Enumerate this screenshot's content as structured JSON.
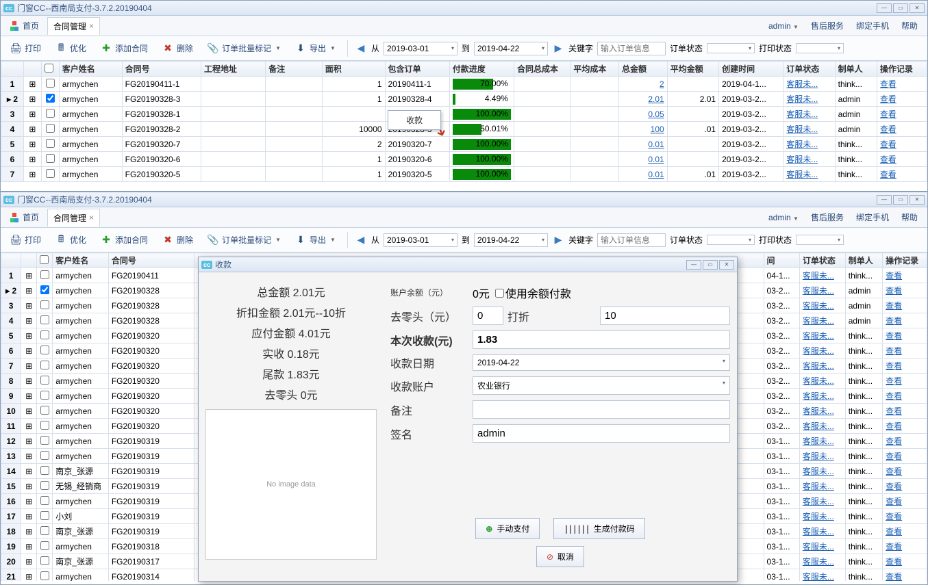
{
  "app_title": "门窗CC--西南局支付-3.7.2.20190404",
  "tabs": {
    "home": "首页",
    "contract": "合同管理"
  },
  "user": {
    "name": "admin",
    "menu1": "售后服务",
    "menu2": "绑定手机",
    "menu3": "帮助"
  },
  "toolbar": {
    "print": "打印",
    "optimize": "优化",
    "add": "添加合同",
    "delete": "删除",
    "batch": "订单批量标记",
    "export": "导出",
    "from": "从",
    "to": "到",
    "date1": "2019-03-01",
    "date2": "2019-04-22",
    "keyword": "关键字",
    "search_ph": "输入订单信息",
    "status": "订单状态",
    "pstatus": "打印状态"
  },
  "cols": [
    "",
    "",
    "",
    "客户姓名",
    "合同号",
    "工程地址",
    "备注",
    "面积",
    "包含订单",
    "付款进度",
    "合同总成本",
    "平均成本",
    "总金额",
    "平均金额",
    "创建时间",
    "订单状态",
    "制单人",
    "操作记录"
  ],
  "ctx": "收款",
  "rows_top": [
    {
      "n": "1",
      "name": "armychen",
      "no": "FG20190411-1",
      "area": "1",
      "order": "20190411-1",
      "prog": 70,
      "ptxt": "70.00%",
      "total": "2",
      "created": "2019-04-1...",
      "status": "客服未...",
      "user": "think...",
      "op": "查看"
    },
    {
      "n": "2",
      "sel": true,
      "cur": true,
      "name": "armychen",
      "no": "FG20190328-3",
      "area": "1",
      "order": "20190328-4",
      "prog": 4.49,
      "ptxt": "4.49%",
      "total": "2.01",
      "avg": "2.01",
      "created": "2019-03-2...",
      "status": "客服未...",
      "user": "admin",
      "op": "查看"
    },
    {
      "n": "3",
      "name": "armychen",
      "no": "FG20190328-1",
      "area": "",
      "order": "",
      "prog": 100,
      "ptxt": "100.00%",
      "total": "0.05",
      "created": "2019-03-2...",
      "status": "客服未...",
      "user": "admin",
      "op": "查看"
    },
    {
      "n": "4",
      "name": "armychen",
      "no": "FG20190328-2",
      "area": "10000",
      "order": "20190328-3",
      "prog": 50,
      "ptxt": "50.01%",
      "total": "100",
      "avg": ".01",
      "created": "2019-03-2...",
      "status": "客服未...",
      "user": "admin",
      "op": "查看"
    },
    {
      "n": "5",
      "name": "armychen",
      "no": "FG20190320-7",
      "area": "2",
      "order": "20190320-7",
      "prog": 100,
      "ptxt": "100.00%",
      "total": "0.01",
      "created": "2019-03-2...",
      "status": "客服未...",
      "user": "think...",
      "op": "查看"
    },
    {
      "n": "6",
      "name": "armychen",
      "no": "FG20190320-6",
      "area": "1",
      "order": "20190320-6",
      "prog": 100,
      "ptxt": "100.00%",
      "total": "0.01",
      "created": "2019-03-2...",
      "status": "客服未...",
      "user": "think...",
      "op": "查看"
    },
    {
      "n": "7",
      "name": "armychen",
      "no": "FG20190320-5",
      "area": "1",
      "order": "20190320-5",
      "prog": 100,
      "ptxt": "100.00%",
      "total": "0.01",
      "avg": ".01",
      "created": "2019-03-2...",
      "status": "客服未...",
      "user": "think...",
      "op": "查看"
    }
  ],
  "cols2": [
    "",
    "",
    "",
    "客户姓名",
    "合同号",
    "间",
    "订单状态",
    "制单人",
    "操作记录"
  ],
  "rows_bottom": [
    {
      "n": "1",
      "name": "armychen",
      "no": "FG20190411",
      "t": "04-1...",
      "status": "客服未...",
      "user": "think...",
      "op": "查看"
    },
    {
      "n": "2",
      "sel": true,
      "cur": true,
      "name": "armychen",
      "no": "FG20190328",
      "t": "03-2...",
      "status": "客服未...",
      "user": "admin",
      "op": "查看"
    },
    {
      "n": "3",
      "name": "armychen",
      "no": "FG20190328",
      "t": "03-2...",
      "status": "客服未...",
      "user": "admin",
      "op": "查看"
    },
    {
      "n": "4",
      "name": "armychen",
      "no": "FG20190328",
      "t": "03-2...",
      "status": "客服未...",
      "user": "admin",
      "op": "查看"
    },
    {
      "n": "5",
      "name": "armychen",
      "no": "FG20190320",
      "t": "03-2...",
      "status": "客服未...",
      "user": "think...",
      "op": "查看"
    },
    {
      "n": "6",
      "name": "armychen",
      "no": "FG20190320",
      "t": "03-2...",
      "status": "客服未...",
      "user": "think...",
      "op": "查看"
    },
    {
      "n": "7",
      "name": "armychen",
      "no": "FG20190320",
      "t": "03-2...",
      "status": "客服未...",
      "user": "think...",
      "op": "查看"
    },
    {
      "n": "8",
      "name": "armychen",
      "no": "FG20190320",
      "t": "03-2...",
      "status": "客服未...",
      "user": "think...",
      "op": "查看"
    },
    {
      "n": "9",
      "name": "armychen",
      "no": "FG20190320",
      "t": "03-2...",
      "status": "客服未...",
      "user": "think...",
      "op": "查看"
    },
    {
      "n": "10",
      "name": "armychen",
      "no": "FG20190320",
      "t": "03-2...",
      "status": "客服未...",
      "user": "think...",
      "op": "查看"
    },
    {
      "n": "11",
      "name": "armychen",
      "no": "FG20190320",
      "t": "03-2...",
      "status": "客服未...",
      "user": "think...",
      "op": "查看"
    },
    {
      "n": "12",
      "name": "armychen",
      "no": "FG20190319",
      "t": "03-1...",
      "status": "客服未...",
      "user": "think...",
      "op": "查看"
    },
    {
      "n": "13",
      "name": "armychen",
      "no": "FG20190319",
      "t": "03-1...",
      "status": "客服未...",
      "user": "think...",
      "op": "查看"
    },
    {
      "n": "14",
      "name": "南京_张源",
      "no": "FG20190319",
      "t": "03-1...",
      "status": "客服未...",
      "user": "think...",
      "op": "查看"
    },
    {
      "n": "15",
      "name": "无锡_经销商",
      "no": "FG20190319",
      "t": "03-1...",
      "status": "客服未...",
      "user": "think...",
      "op": "查看"
    },
    {
      "n": "16",
      "name": "armychen",
      "no": "FG20190319",
      "t": "03-1...",
      "status": "客服未...",
      "user": "think...",
      "op": "查看"
    },
    {
      "n": "17",
      "name": "小刘",
      "no": "FG20190319",
      "t": "03-1...",
      "status": "客服未...",
      "user": "think...",
      "op": "查看"
    },
    {
      "n": "18",
      "name": "南京_张源",
      "no": "FG20190319",
      "t": "03-1...",
      "status": "客服未...",
      "user": "think...",
      "op": "查看"
    },
    {
      "n": "19",
      "name": "armychen",
      "no": "FG20190318",
      "t": "03-1...",
      "status": "客服未...",
      "user": "think...",
      "op": "查看"
    },
    {
      "n": "20",
      "name": "南京_张源",
      "no": "FG20190317",
      "t": "03-1...",
      "status": "客服未...",
      "user": "think...",
      "op": "查看"
    },
    {
      "n": "21",
      "name": "armychen",
      "no": "FG20190314",
      "t": "03-1...",
      "status": "客服未...",
      "user": "think...",
      "op": "查看"
    }
  ],
  "dialog": {
    "title": "收款",
    "total": "总金额 2.01元",
    "discount": "折扣金额 2.01元--10折",
    "payable": "应付金额 4.01元",
    "received": "实收 0.18元",
    "tail": "尾款 1.83元",
    "round": "去零头 0元",
    "noimg": "No image data",
    "balance_lbl": "账户余额（元）",
    "balance_val": "0元",
    "use_balance": "使用余额付款",
    "round_lbl": "去零头（元）",
    "round_val": "0",
    "disc_lbl": "打折",
    "disc_val": "10",
    "this_lbl": "本次收款(元)",
    "this_val": "1.83",
    "date_lbl": "收款日期",
    "date_val": "2019-04-22",
    "acct_lbl": "收款账户",
    "acct_val": "农业银行",
    "note_lbl": "备注",
    "sign_lbl": "签名",
    "sign_val": "admin",
    "manual": "手动支付",
    "qr": "生成付款码",
    "cancel": "取消"
  }
}
